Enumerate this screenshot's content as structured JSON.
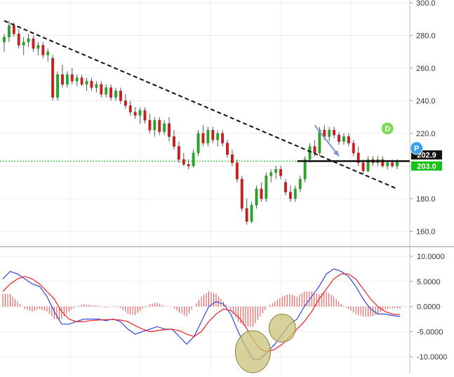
{
  "chart_data": [
    {
      "type": "candlestick",
      "title": "",
      "y_axis": {
        "ticks": [
          "300.0",
          "280.0",
          "260.0",
          "240.0",
          "220.0",
          "200.0",
          "180.0",
          "160.0"
        ],
        "tick_values": [
          300,
          280,
          260,
          240,
          220,
          200,
          180,
          160
        ],
        "range": [
          152,
          300
        ],
        "side": "right"
      },
      "grid": true,
      "ohlc": [
        {
          "o": 276,
          "h": 281,
          "l": 270,
          "c": 279
        },
        {
          "o": 279,
          "h": 289,
          "l": 276,
          "c": 286
        },
        {
          "o": 286,
          "h": 288,
          "l": 279,
          "c": 281
        },
        {
          "o": 281,
          "h": 284,
          "l": 272,
          "c": 274
        },
        {
          "o": 274,
          "h": 279,
          "l": 268,
          "c": 276
        },
        {
          "o": 276,
          "h": 281,
          "l": 273,
          "c": 278
        },
        {
          "o": 278,
          "h": 280,
          "l": 270,
          "c": 272
        },
        {
          "o": 272,
          "h": 276,
          "l": 268,
          "c": 274
        },
        {
          "o": 274,
          "h": 276,
          "l": 266,
          "c": 268
        },
        {
          "o": 268,
          "h": 272,
          "l": 264,
          "c": 270
        },
        {
          "o": 266,
          "h": 268,
          "l": 240,
          "c": 242
        },
        {
          "o": 242,
          "h": 258,
          "l": 240,
          "c": 256
        },
        {
          "o": 256,
          "h": 262,
          "l": 248,
          "c": 250
        },
        {
          "o": 250,
          "h": 258,
          "l": 248,
          "c": 256
        },
        {
          "o": 256,
          "h": 260,
          "l": 250,
          "c": 252
        },
        {
          "o": 252,
          "h": 256,
          "l": 249,
          "c": 254
        },
        {
          "o": 254,
          "h": 256,
          "l": 249,
          "c": 250
        },
        {
          "o": 250,
          "h": 254,
          "l": 246,
          "c": 252
        },
        {
          "o": 252,
          "h": 254,
          "l": 246,
          "c": 248
        },
        {
          "o": 248,
          "h": 252,
          "l": 245,
          "c": 250
        },
        {
          "o": 250,
          "h": 252,
          "l": 242,
          "c": 244
        },
        {
          "o": 244,
          "h": 250,
          "l": 242,
          "c": 248
        },
        {
          "o": 248,
          "h": 250,
          "l": 240,
          "c": 242
        },
        {
          "o": 242,
          "h": 248,
          "l": 240,
          "c": 246
        },
        {
          "o": 246,
          "h": 248,
          "l": 238,
          "c": 240
        },
        {
          "o": 240,
          "h": 244,
          "l": 235,
          "c": 237
        },
        {
          "o": 237,
          "h": 240,
          "l": 231,
          "c": 233
        },
        {
          "o": 233,
          "h": 236,
          "l": 229,
          "c": 231
        },
        {
          "o": 231,
          "h": 236,
          "l": 226,
          "c": 234
        },
        {
          "o": 234,
          "h": 236,
          "l": 226,
          "c": 228
        },
        {
          "o": 228,
          "h": 232,
          "l": 220,
          "c": 222
        },
        {
          "o": 222,
          "h": 230,
          "l": 218,
          "c": 228
        },
        {
          "o": 228,
          "h": 230,
          "l": 219,
          "c": 221
        },
        {
          "o": 221,
          "h": 228,
          "l": 219,
          "c": 226
        },
        {
          "o": 226,
          "h": 230,
          "l": 215,
          "c": 218
        },
        {
          "o": 218,
          "h": 222,
          "l": 210,
          "c": 212
        },
        {
          "o": 212,
          "h": 215,
          "l": 202,
          "c": 204
        },
        {
          "o": 204,
          "h": 208,
          "l": 200,
          "c": 201
        },
        {
          "o": 201,
          "h": 204,
          "l": 198,
          "c": 200
        },
        {
          "o": 200,
          "h": 210,
          "l": 199,
          "c": 208
        },
        {
          "o": 208,
          "h": 222,
          "l": 206,
          "c": 220
        },
        {
          "o": 220,
          "h": 225,
          "l": 212,
          "c": 214
        },
        {
          "o": 214,
          "h": 224,
          "l": 212,
          "c": 222
        },
        {
          "o": 222,
          "h": 224,
          "l": 214,
          "c": 216
        },
        {
          "o": 216,
          "h": 222,
          "l": 212,
          "c": 220
        },
        {
          "o": 220,
          "h": 222,
          "l": 212,
          "c": 214
        },
        {
          "o": 214,
          "h": 216,
          "l": 205,
          "c": 207
        },
        {
          "o": 207,
          "h": 210,
          "l": 200,
          "c": 202
        },
        {
          "o": 202,
          "h": 204,
          "l": 190,
          "c": 192
        },
        {
          "o": 192,
          "h": 194,
          "l": 172,
          "c": 174
        },
        {
          "o": 174,
          "h": 180,
          "l": 164,
          "c": 166
        },
        {
          "o": 166,
          "h": 178,
          "l": 165,
          "c": 176
        },
        {
          "o": 176,
          "h": 188,
          "l": 174,
          "c": 186
        },
        {
          "o": 186,
          "h": 190,
          "l": 178,
          "c": 180
        },
        {
          "o": 180,
          "h": 196,
          "l": 178,
          "c": 194
        },
        {
          "o": 194,
          "h": 198,
          "l": 190,
          "c": 196
        },
        {
          "o": 196,
          "h": 200,
          "l": 192,
          "c": 198
        },
        {
          "o": 198,
          "h": 200,
          "l": 192,
          "c": 194
        },
        {
          "o": 190,
          "h": 192,
          "l": 182,
          "c": 184
        },
        {
          "o": 184,
          "h": 188,
          "l": 178,
          "c": 180
        },
        {
          "o": 180,
          "h": 188,
          "l": 178,
          "c": 186
        },
        {
          "o": 186,
          "h": 194,
          "l": 184,
          "c": 192
        },
        {
          "o": 192,
          "h": 206,
          "l": 190,
          "c": 204
        },
        {
          "o": 204,
          "h": 214,
          "l": 202,
          "c": 212
        },
        {
          "o": 212,
          "h": 216,
          "l": 206,
          "c": 208
        },
        {
          "o": 208,
          "h": 224,
          "l": 206,
          "c": 222
        },
        {
          "o": 222,
          "h": 225,
          "l": 216,
          "c": 218
        },
        {
          "o": 218,
          "h": 224,
          "l": 215,
          "c": 222
        },
        {
          "o": 222,
          "h": 224,
          "l": 217,
          "c": 219
        },
        {
          "o": 219,
          "h": 221,
          "l": 213,
          "c": 215
        },
        {
          "o": 215,
          "h": 220,
          "l": 213,
          "c": 218
        },
        {
          "o": 218,
          "h": 220,
          "l": 212,
          "c": 214
        },
        {
          "o": 214,
          "h": 216,
          "l": 206,
          "c": 208
        },
        {
          "o": 208,
          "h": 212,
          "l": 200,
          "c": 202
        },
        {
          "o": 202,
          "h": 204,
          "l": 195,
          "c": 197
        },
        {
          "o": 197,
          "h": 206,
          "l": 196,
          "c": 204
        },
        {
          "o": 204,
          "h": 206,
          "l": 200,
          "c": 202
        },
        {
          "o": 202,
          "h": 206,
          "l": 200,
          "c": 204
        },
        {
          "o": 204,
          "h": 206,
          "l": 199,
          "c": 200
        },
        {
          "o": 200,
          "h": 203,
          "l": 198,
          "c": 202
        },
        {
          "o": 202,
          "h": 204,
          "l": 199,
          "c": 200
        },
        {
          "o": 200,
          "h": 204,
          "l": 198,
          "c": 203
        }
      ],
      "trendline": {
        "start": {
          "index": 0,
          "value": 289
        },
        "end": {
          "index": 81,
          "value": 186
        },
        "style": "dashed"
      },
      "horizontal_line": {
        "value": 203.0,
        "from_index": 61,
        "to_index": 81
      },
      "price_labels": [
        {
          "text": "202.9",
          "value": 202.9,
          "color": "#111111"
        },
        {
          "text": "203.0",
          "value": 203.0,
          "color": "#17c117"
        }
      ],
      "current_level_line": {
        "value": 203.0,
        "color": "#22bb22",
        "style": "dotted"
      },
      "markers": [
        {
          "label": "D",
          "index": 79,
          "value": 223,
          "color": "#7ed957"
        },
        {
          "label": "P",
          "index": 85,
          "value": 211,
          "color": "#3aa0e8"
        }
      ],
      "arrow": {
        "from": {
          "index": 64,
          "value": 225
        },
        "to": {
          "index": 69,
          "value": 206
        },
        "color": "#7b98c8"
      },
      "colors": {
        "up": "#2aa32a",
        "down": "#c42121"
      }
    },
    {
      "type": "macd",
      "y_axis": {
        "ticks": [
          "10.0000",
          "5.0000",
          "0.0000",
          "-5.0000",
          "-10.0000"
        ],
        "tick_values": [
          10,
          5,
          0,
          -5,
          -10
        ],
        "range": [
          -12.5,
          11
        ],
        "side": "right"
      },
      "grid": true,
      "series": [
        {
          "key": "macd",
          "color": "#3344dd",
          "values": [
            5.5,
            7.0,
            6.5,
            5.5,
            4.5,
            4.0,
            2.0,
            -1.0,
            -3.5,
            -3.5,
            -3.0,
            -2.5,
            -2.5,
            -2.5,
            -2.8,
            -2.5,
            -3.0,
            -4.5,
            -5.5,
            -5.0,
            -4.5,
            -4.0,
            -4.5,
            -4.5,
            -6.0,
            -7.5,
            -6.0,
            -3.0,
            0.0,
            1.0,
            0.5,
            -1.5,
            -5.0,
            -8.0,
            -10.5,
            -10.5,
            -9.0,
            -7.5,
            -5.5,
            -3.5,
            -2.5,
            0.0,
            2.0,
            4.0,
            6.5,
            7.5,
            7.0,
            6.0,
            4.0,
            1.5,
            -0.5,
            -1.5,
            -1.5,
            -1.8,
            -2.0
          ]
        },
        {
          "key": "signal",
          "color": "#ee2222",
          "values": [
            3.0,
            4.5,
            5.5,
            6.0,
            5.5,
            4.5,
            3.0,
            1.5,
            -1.0,
            -2.5,
            -3.0,
            -3.0,
            -2.8,
            -2.7,
            -2.6,
            -2.6,
            -2.7,
            -3.0,
            -3.8,
            -4.5,
            -5.0,
            -4.8,
            -4.6,
            -4.5,
            -4.8,
            -5.5,
            -6.0,
            -5.0,
            -3.0,
            -1.5,
            -0.5,
            -0.8,
            -2.0,
            -4.0,
            -6.5,
            -8.5,
            -9.0,
            -8.5,
            -7.5,
            -6.0,
            -4.5,
            -3.0,
            -1.0,
            1.5,
            3.5,
            5.5,
            6.5,
            6.5,
            5.5,
            3.5,
            1.5,
            0.0,
            -1.0,
            -1.5,
            -1.6
          ]
        },
        {
          "key": "histogram",
          "color": "#ee4444",
          "values": [
            2.5,
            2.5,
            1.0,
            -0.5,
            -1.0,
            -0.5,
            -1.0,
            -2.5,
            -2.5,
            -1.0,
            0.0,
            0.5,
            0.3,
            0.2,
            -0.2,
            0.1,
            -0.3,
            -1.5,
            -1.7,
            -0.5,
            0.5,
            0.8,
            0.1,
            0.0,
            -1.2,
            -2.0,
            0.0,
            2.0,
            3.0,
            2.5,
            1.0,
            -0.7,
            -3.0,
            -4.0,
            -4.0,
            -2.0,
            0.0,
            1.0,
            2.0,
            2.5,
            2.0,
            3.0,
            3.0,
            2.5,
            3.0,
            2.0,
            0.5,
            -0.5,
            -1.5,
            -2.0,
            -2.0,
            -1.5,
            -0.5,
            -0.3,
            -0.4
          ]
        }
      ],
      "highlights": [
        {
          "center_index": 34,
          "value": -9.0,
          "color": "#c9c27a"
        },
        {
          "center_index": 38,
          "value": -4.3,
          "color": "#c9c27a"
        }
      ]
    }
  ]
}
